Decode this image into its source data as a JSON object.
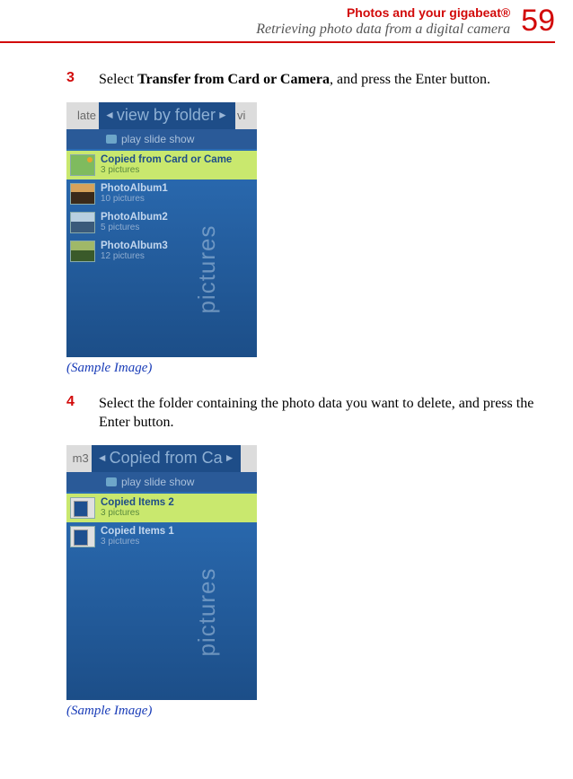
{
  "header": {
    "chapter": "Photos and your gigabeat®",
    "section": "Retrieving photo data from a digital camera",
    "page_number": "59"
  },
  "steps": [
    {
      "num": "3",
      "prefix": "Select ",
      "bold": "Transfer from Card or Camera",
      "suffix": ", and press the Enter button."
    },
    {
      "num": "4",
      "prefix": "Select the folder containing the photo data you want to delete, and press the Enter button.",
      "bold": "",
      "suffix": ""
    }
  ],
  "captions": {
    "sample1": "(Sample Image)",
    "sample2": "(Sample Image)"
  },
  "screenshot1": {
    "left_tab": "late",
    "title": "view by folder",
    "right_tab": "vi",
    "sub": "play slide show",
    "side": "pictures",
    "rows": [
      {
        "title": "Copied from Card or Came",
        "sub": "3 pictures",
        "highlight": true,
        "thumb": "green"
      },
      {
        "title": "PhotoAlbum1",
        "sub": "10 pictures",
        "highlight": false,
        "thumb": "sunset"
      },
      {
        "title": "PhotoAlbum2",
        "sub": "5 pictures",
        "highlight": false,
        "thumb": "sea"
      },
      {
        "title": "PhotoAlbum3",
        "sub": "12 pictures",
        "highlight": false,
        "thumb": "hill"
      }
    ]
  },
  "screenshot2": {
    "left_tab": "m3",
    "title": "Copied from Ca",
    "right_tab": "",
    "sub": "play slide show",
    "side": "pictures",
    "rows": [
      {
        "title": "Copied Items 2",
        "sub": "3 pictures",
        "highlight": true,
        "thumb": "card"
      },
      {
        "title": "Copied Items 1",
        "sub": "3 pictures",
        "highlight": false,
        "thumb": "card"
      }
    ]
  }
}
